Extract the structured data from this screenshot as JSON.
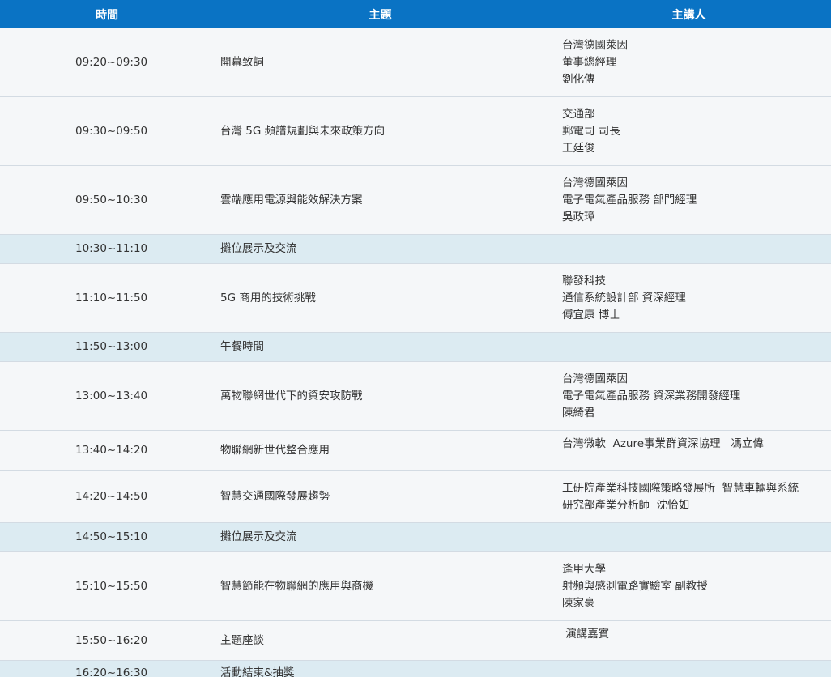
{
  "headers": {
    "time": "時間",
    "topic": "主題",
    "speaker": "主講人"
  },
  "rows": [
    {
      "time": "09:20~09:30",
      "topic": "開幕致詞",
      "speaker": [
        "台灣德國萊因",
        "董事總經理",
        "劉化傳"
      ]
    },
    {
      "time": "09:30~09:50",
      "topic": "台灣 5G 頻譜規劃與未來政策方向",
      "speaker": [
        "交通部",
        "郵電司 司長",
        "王廷俊"
      ]
    },
    {
      "time": "09:50~10:30",
      "topic": "雲端應用電源與能效解決方案",
      "speaker": [
        "台灣德國萊因",
        "電子電氣產品服務 部門經理",
        "吳政璋"
      ]
    },
    {
      "time": "10:30~11:10",
      "topic": "攤位展示及交流",
      "speaker": []
    },
    {
      "time": "11:10~11:50",
      "topic": "5G 商用的技術挑戰",
      "speaker": [
        "聯發科技",
        "通信系統設計部 資深經理",
        "傅宜康 博士"
      ]
    },
    {
      "time": "11:50~13:00",
      "topic": "午餐時間",
      "speaker": []
    },
    {
      "time": "13:00~13:40",
      "topic": "萬物聯網世代下的資安攻防戰",
      "speaker": [
        "台灣德國萊因",
        "電子電氣產品服務 資深業務開發經理",
        "陳綺君"
      ]
    },
    {
      "time": "13:40~14:20",
      "topic": "物聯網新世代整合應用",
      "speaker": [
        "台灣微軟  Azure事業群資深協理   馮立偉"
      ]
    },
    {
      "time": "14:20~14:50",
      "topic": "智慧交通國際發展趨勢",
      "speaker": [
        "工研院產業科技國際策略發展所  智慧車輛與系統",
        "研究部產業分析師  沈怡如"
      ]
    },
    {
      "time": "14:50~15:10",
      "topic": "攤位展示及交流",
      "speaker": []
    },
    {
      "time": "15:10~15:50",
      "topic": "智慧節能在物聯網的應用與商機",
      "speaker": [
        "逢甲大學",
        "射頻與感測電路實驗室 副教授",
        "陳家豪"
      ]
    },
    {
      "time": "15:50~16:20",
      "topic": "主題座談",
      "speaker": [
        " 演講嘉賓"
      ]
    },
    {
      "time": "16:20~16:30",
      "topic": "活動結束&抽獎",
      "speaker": []
    }
  ]
}
